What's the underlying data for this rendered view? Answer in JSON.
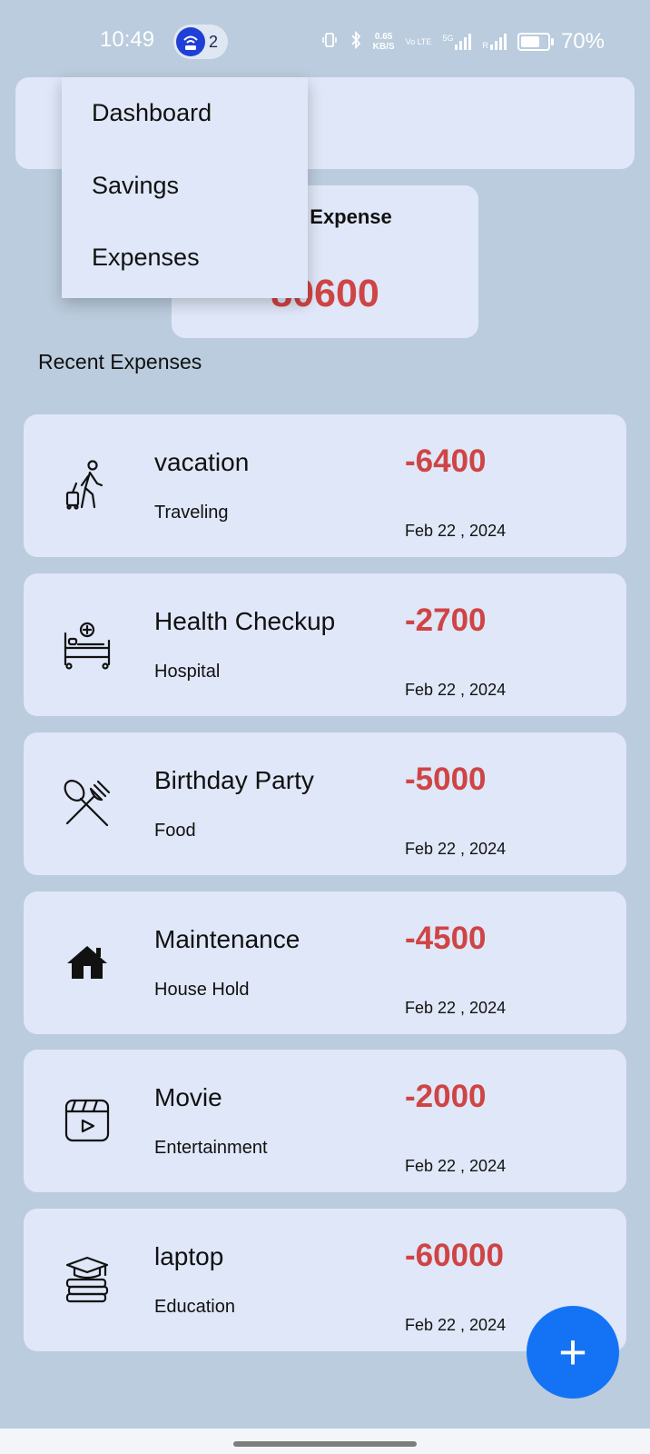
{
  "status_bar": {
    "time": "10:49",
    "hotspot_count": "2",
    "net_speed": "0.65",
    "net_speed_unit": "KB/S",
    "volte": "Vo LTE",
    "network": "5G",
    "roaming": "R",
    "battery_pct": "70%",
    "battery_level": 0.7
  },
  "menu": {
    "items": [
      {
        "label": "Dashboard"
      },
      {
        "label": "Savings"
      },
      {
        "label": "Expenses"
      }
    ]
  },
  "total_card": {
    "label": "Total Expense",
    "amount": "80600"
  },
  "recent": {
    "title": "Recent Expenses",
    "items": [
      {
        "name": "vacation",
        "category": "Traveling",
        "amount": "-6400",
        "date": "Feb 22 , 2024",
        "icon": "traveler-icon"
      },
      {
        "name": "Health Checkup",
        "category": "Hospital",
        "amount": "-2700",
        "date": "Feb 22 , 2024",
        "icon": "hospital-bed-icon"
      },
      {
        "name": "Birthday Party",
        "category": "Food",
        "amount": "-5000",
        "date": "Feb 22 , 2024",
        "icon": "spoon-fork-icon"
      },
      {
        "name": "Maintenance",
        "category": "House Hold",
        "amount": "-4500",
        "date": "Feb 22 , 2024",
        "icon": "house-icon"
      },
      {
        "name": "Movie",
        "category": "Entertainment",
        "amount": "-2000",
        "date": "Feb 22 , 2024",
        "icon": "movie-clapper-icon"
      },
      {
        "name": "laptop",
        "category": "Education",
        "amount": "-60000",
        "date": "Feb 22 , 2024",
        "icon": "graduation-books-icon"
      }
    ]
  },
  "fab": {
    "label": "+"
  },
  "colors": {
    "accent": "#1473F5",
    "negative": "#CF4444",
    "card": "#DFE7F8",
    "background": "#BACCDD"
  }
}
